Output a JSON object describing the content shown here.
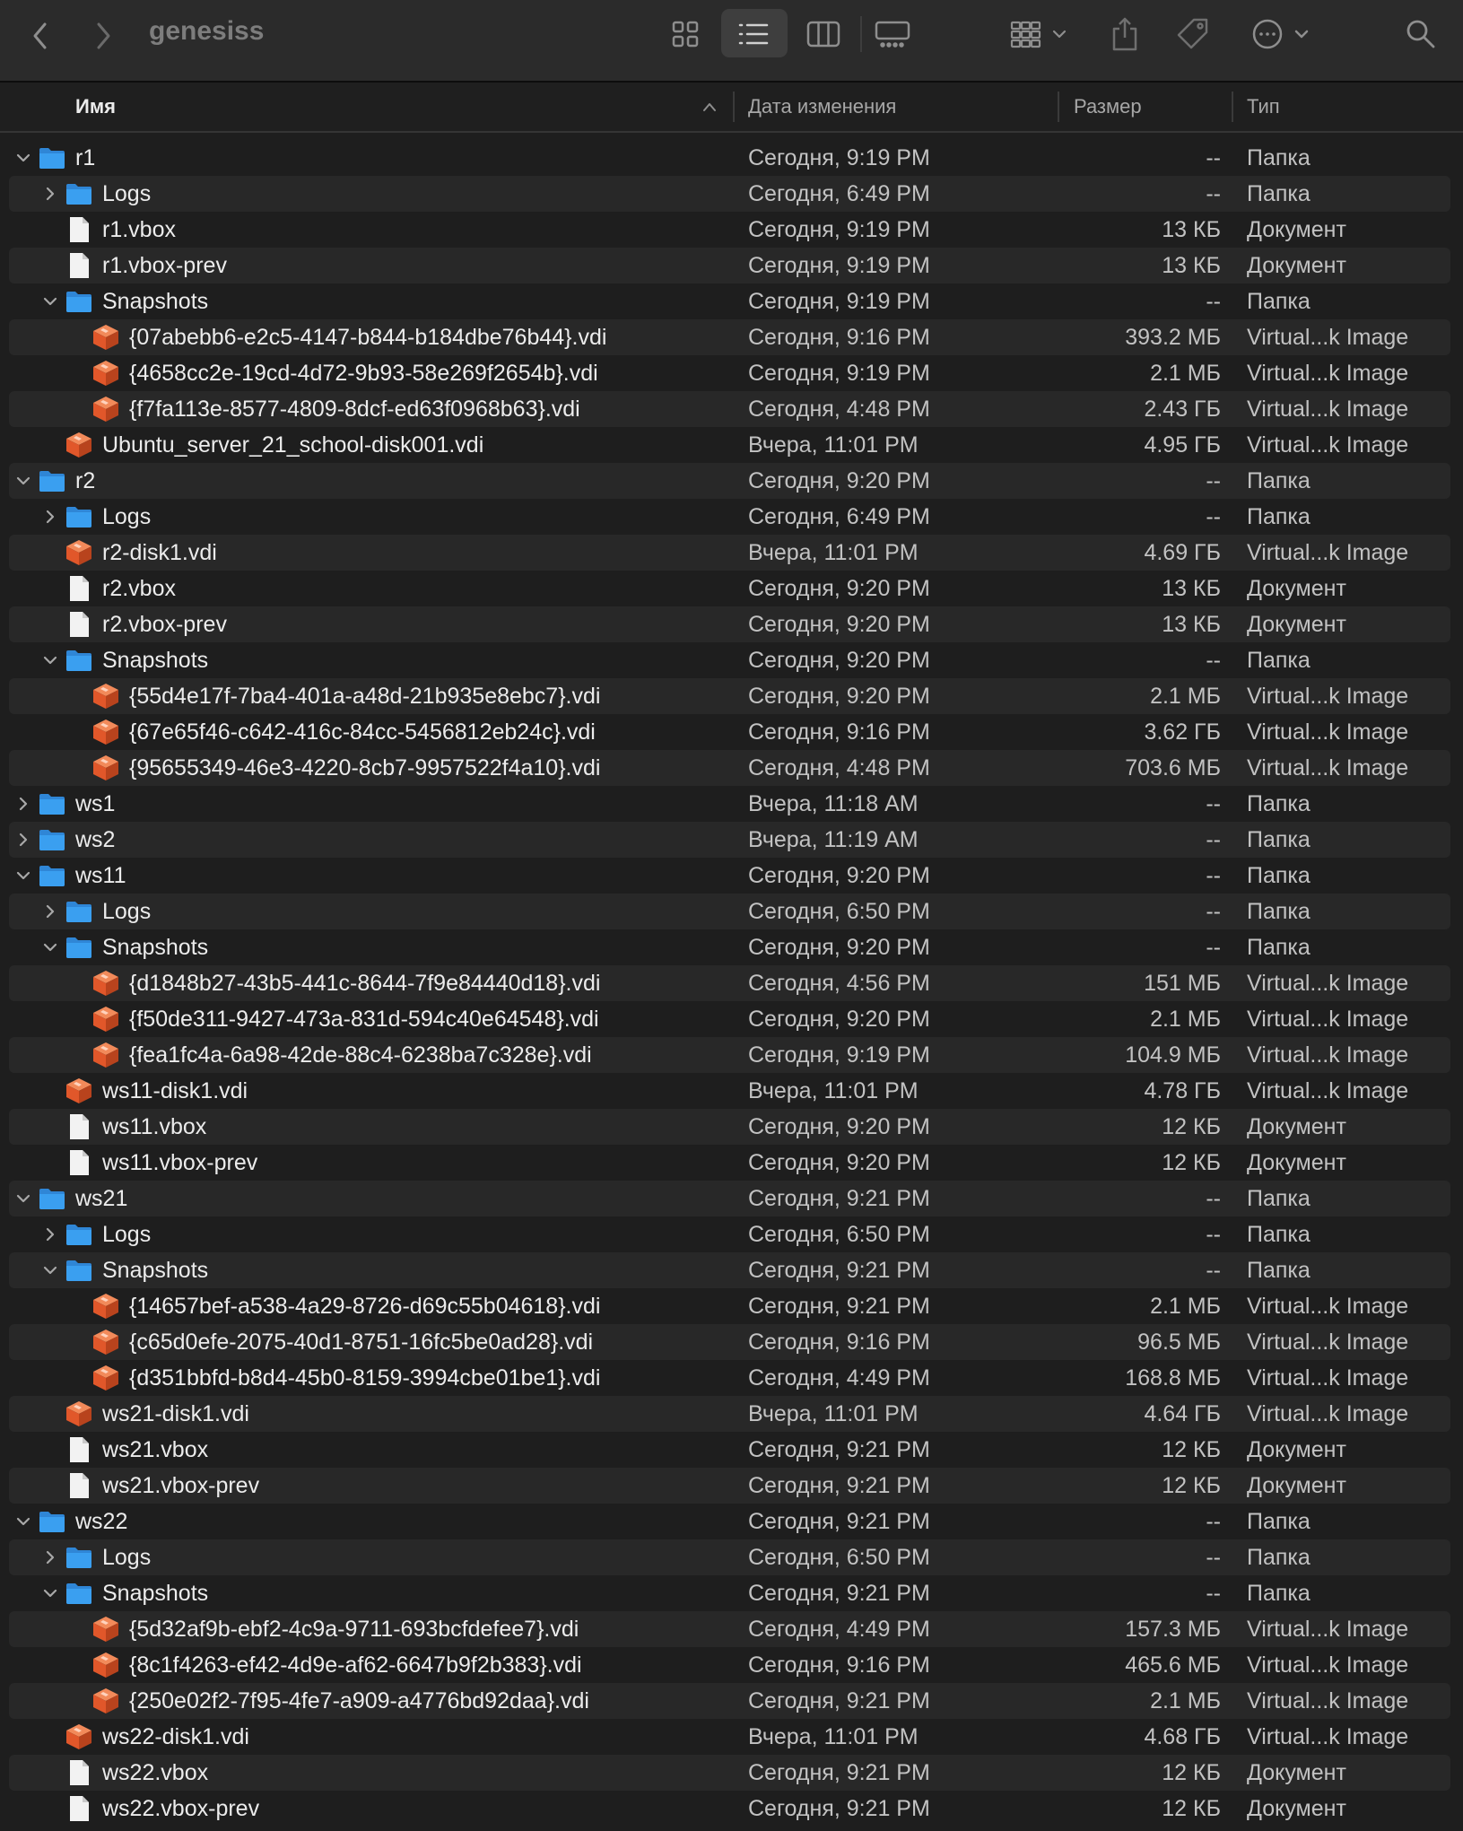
{
  "window": {
    "title": "genesiss",
    "back_label": "‹",
    "forward_label": "›"
  },
  "header": {
    "name": "Имя",
    "date": "Дата изменения",
    "size": "Размер",
    "type": "Тип"
  },
  "colors": {
    "folder": "#3a9ff0",
    "vdi": "#e1572a",
    "doc": "#f2f2f2",
    "alt_row": "#282828"
  },
  "icons": [
    "back-icon",
    "forward-icon",
    "icon-view-icon",
    "list-view-icon",
    "column-view-icon",
    "gallery-view-icon",
    "group-icon",
    "share-icon",
    "tag-icon",
    "more-icon",
    "search-icon"
  ],
  "rows": [
    {
      "level": 0,
      "kind": "folder",
      "disclosure": "open",
      "name": "r1",
      "date": "Сегодня, 9:19 PM",
      "size": "--",
      "type": "Папка"
    },
    {
      "level": 1,
      "kind": "folder",
      "disclosure": "closed",
      "name": "Logs",
      "date": "Сегодня, 6:49 PM",
      "size": "--",
      "type": "Папка"
    },
    {
      "level": 1,
      "kind": "doc",
      "disclosure": "none",
      "name": "r1.vbox",
      "date": "Сегодня, 9:19 PM",
      "size": "13 КБ",
      "type": "Документ"
    },
    {
      "level": 1,
      "kind": "doc",
      "disclosure": "none",
      "name": "r1.vbox-prev",
      "date": "Сегодня, 9:19 PM",
      "size": "13 КБ",
      "type": "Документ"
    },
    {
      "level": 1,
      "kind": "folder",
      "disclosure": "open",
      "name": "Snapshots",
      "date": "Сегодня, 9:19 PM",
      "size": "--",
      "type": "Папка"
    },
    {
      "level": 2,
      "kind": "vdi",
      "disclosure": "none",
      "name": "{07abebb6-e2c5-4147-b844-b184dbe76b44}.vdi",
      "date": "Сегодня, 9:16 PM",
      "size": "393.2 МБ",
      "type": "Virtual...k Image"
    },
    {
      "level": 2,
      "kind": "vdi",
      "disclosure": "none",
      "name": "{4658cc2e-19cd-4d72-9b93-58e269f2654b}.vdi",
      "date": "Сегодня, 9:19 PM",
      "size": "2.1 МБ",
      "type": "Virtual...k Image"
    },
    {
      "level": 2,
      "kind": "vdi",
      "disclosure": "none",
      "name": "{f7fa113e-8577-4809-8dcf-ed63f0968b63}.vdi",
      "date": "Сегодня, 4:48 PM",
      "size": "2.43 ГБ",
      "type": "Virtual...k Image"
    },
    {
      "level": 1,
      "kind": "vdi",
      "disclosure": "none",
      "name": "Ubuntu_server_21_school-disk001.vdi",
      "date": "Вчера, 11:01 PM",
      "size": "4.95 ГБ",
      "type": "Virtual...k Image"
    },
    {
      "level": 0,
      "kind": "folder",
      "disclosure": "open",
      "name": "r2",
      "date": "Сегодня, 9:20 PM",
      "size": "--",
      "type": "Папка"
    },
    {
      "level": 1,
      "kind": "folder",
      "disclosure": "closed",
      "name": "Logs",
      "date": "Сегодня, 6:49 PM",
      "size": "--",
      "type": "Папка"
    },
    {
      "level": 1,
      "kind": "vdi",
      "disclosure": "none",
      "name": "r2-disk1.vdi",
      "date": "Вчера, 11:01 PM",
      "size": "4.69 ГБ",
      "type": "Virtual...k Image"
    },
    {
      "level": 1,
      "kind": "doc",
      "disclosure": "none",
      "name": "r2.vbox",
      "date": "Сегодня, 9:20 PM",
      "size": "13 КБ",
      "type": "Документ"
    },
    {
      "level": 1,
      "kind": "doc",
      "disclosure": "none",
      "name": "r2.vbox-prev",
      "date": "Сегодня, 9:20 PM",
      "size": "13 КБ",
      "type": "Документ"
    },
    {
      "level": 1,
      "kind": "folder",
      "disclosure": "open",
      "name": "Snapshots",
      "date": "Сегодня, 9:20 PM",
      "size": "--",
      "type": "Папка"
    },
    {
      "level": 2,
      "kind": "vdi",
      "disclosure": "none",
      "name": "{55d4e17f-7ba4-401a-a48d-21b935e8ebc7}.vdi",
      "date": "Сегодня, 9:20 PM",
      "size": "2.1 МБ",
      "type": "Virtual...k Image"
    },
    {
      "level": 2,
      "kind": "vdi",
      "disclosure": "none",
      "name": "{67e65f46-c642-416c-84cc-5456812eb24c}.vdi",
      "date": "Сегодня, 9:16 PM",
      "size": "3.62 ГБ",
      "type": "Virtual...k Image"
    },
    {
      "level": 2,
      "kind": "vdi",
      "disclosure": "none",
      "name": "{95655349-46e3-4220-8cb7-9957522f4a10}.vdi",
      "date": "Сегодня, 4:48 PM",
      "size": "703.6 МБ",
      "type": "Virtual...k Image"
    },
    {
      "level": 0,
      "kind": "folder",
      "disclosure": "closed",
      "name": "ws1",
      "date": "Вчера, 11:18 AM",
      "size": "--",
      "type": "Папка"
    },
    {
      "level": 0,
      "kind": "folder",
      "disclosure": "closed",
      "name": "ws2",
      "date": "Вчера, 11:19 AM",
      "size": "--",
      "type": "Папка"
    },
    {
      "level": 0,
      "kind": "folder",
      "disclosure": "open",
      "name": "ws11",
      "date": "Сегодня, 9:20 PM",
      "size": "--",
      "type": "Папка"
    },
    {
      "level": 1,
      "kind": "folder",
      "disclosure": "closed",
      "name": "Logs",
      "date": "Сегодня, 6:50 PM",
      "size": "--",
      "type": "Папка"
    },
    {
      "level": 1,
      "kind": "folder",
      "disclosure": "open",
      "name": "Snapshots",
      "date": "Сегодня, 9:20 PM",
      "size": "--",
      "type": "Папка"
    },
    {
      "level": 2,
      "kind": "vdi",
      "disclosure": "none",
      "name": "{d1848b27-43b5-441c-8644-7f9e84440d18}.vdi",
      "date": "Сегодня, 4:56 PM",
      "size": "151 МБ",
      "type": "Virtual...k Image"
    },
    {
      "level": 2,
      "kind": "vdi",
      "disclosure": "none",
      "name": "{f50de311-9427-473a-831d-594c40e64548}.vdi",
      "date": "Сегодня, 9:20 PM",
      "size": "2.1 МБ",
      "type": "Virtual...k Image"
    },
    {
      "level": 2,
      "kind": "vdi",
      "disclosure": "none",
      "name": "{fea1fc4a-6a98-42de-88c4-6238ba7c328e}.vdi",
      "date": "Сегодня, 9:19 PM",
      "size": "104.9 МБ",
      "type": "Virtual...k Image"
    },
    {
      "level": 1,
      "kind": "vdi",
      "disclosure": "none",
      "name": "ws11-disk1.vdi",
      "date": "Вчера, 11:01 PM",
      "size": "4.78 ГБ",
      "type": "Virtual...k Image"
    },
    {
      "level": 1,
      "kind": "doc",
      "disclosure": "none",
      "name": "ws11.vbox",
      "date": "Сегодня, 9:20 PM",
      "size": "12 КБ",
      "type": "Документ"
    },
    {
      "level": 1,
      "kind": "doc",
      "disclosure": "none",
      "name": "ws11.vbox-prev",
      "date": "Сегодня, 9:20 PM",
      "size": "12 КБ",
      "type": "Документ"
    },
    {
      "level": 0,
      "kind": "folder",
      "disclosure": "open",
      "name": "ws21",
      "date": "Сегодня, 9:21 PM",
      "size": "--",
      "type": "Папка"
    },
    {
      "level": 1,
      "kind": "folder",
      "disclosure": "closed",
      "name": "Logs",
      "date": "Сегодня, 6:50 PM",
      "size": "--",
      "type": "Папка"
    },
    {
      "level": 1,
      "kind": "folder",
      "disclosure": "open",
      "name": "Snapshots",
      "date": "Сегодня, 9:21 PM",
      "size": "--",
      "type": "Папка"
    },
    {
      "level": 2,
      "kind": "vdi",
      "disclosure": "none",
      "name": "{14657bef-a538-4a29-8726-d69c55b04618}.vdi",
      "date": "Сегодня, 9:21 PM",
      "size": "2.1 МБ",
      "type": "Virtual...k Image"
    },
    {
      "level": 2,
      "kind": "vdi",
      "disclosure": "none",
      "name": "{c65d0efe-2075-40d1-8751-16fc5be0ad28}.vdi",
      "date": "Сегодня, 9:16 PM",
      "size": "96.5 МБ",
      "type": "Virtual...k Image"
    },
    {
      "level": 2,
      "kind": "vdi",
      "disclosure": "none",
      "name": "{d351bbfd-b8d4-45b0-8159-3994cbe01be1}.vdi",
      "date": "Сегодня, 4:49 PM",
      "size": "168.8 МБ",
      "type": "Virtual...k Image"
    },
    {
      "level": 1,
      "kind": "vdi",
      "disclosure": "none",
      "name": "ws21-disk1.vdi",
      "date": "Вчера, 11:01 PM",
      "size": "4.64 ГБ",
      "type": "Virtual...k Image"
    },
    {
      "level": 1,
      "kind": "doc",
      "disclosure": "none",
      "name": "ws21.vbox",
      "date": "Сегодня, 9:21 PM",
      "size": "12 КБ",
      "type": "Документ"
    },
    {
      "level": 1,
      "kind": "doc",
      "disclosure": "none",
      "name": "ws21.vbox-prev",
      "date": "Сегодня, 9:21 PM",
      "size": "12 КБ",
      "type": "Документ"
    },
    {
      "level": 0,
      "kind": "folder",
      "disclosure": "open",
      "name": "ws22",
      "date": "Сегодня, 9:21 PM",
      "size": "--",
      "type": "Папка"
    },
    {
      "level": 1,
      "kind": "folder",
      "disclosure": "closed",
      "name": "Logs",
      "date": "Сегодня, 6:50 PM",
      "size": "--",
      "type": "Папка"
    },
    {
      "level": 1,
      "kind": "folder",
      "disclosure": "open",
      "name": "Snapshots",
      "date": "Сегодня, 9:21 PM",
      "size": "--",
      "type": "Папка"
    },
    {
      "level": 2,
      "kind": "vdi",
      "disclosure": "none",
      "name": "{5d32af9b-ebf2-4c9a-9711-693bcfdefee7}.vdi",
      "date": "Сегодня, 4:49 PM",
      "size": "157.3 МБ",
      "type": "Virtual...k Image"
    },
    {
      "level": 2,
      "kind": "vdi",
      "disclosure": "none",
      "name": "{8c1f4263-ef42-4d9e-af62-6647b9f2b383}.vdi",
      "date": "Сегодня, 9:16 PM",
      "size": "465.6 МБ",
      "type": "Virtual...k Image"
    },
    {
      "level": 2,
      "kind": "vdi",
      "disclosure": "none",
      "name": "{250e02f2-7f95-4fe7-a909-a4776bd92daa}.vdi",
      "date": "Сегодня, 9:21 PM",
      "size": "2.1 МБ",
      "type": "Virtual...k Image"
    },
    {
      "level": 1,
      "kind": "vdi",
      "disclosure": "none",
      "name": "ws22-disk1.vdi",
      "date": "Вчера, 11:01 PM",
      "size": "4.68 ГБ",
      "type": "Virtual...k Image"
    },
    {
      "level": 1,
      "kind": "doc",
      "disclosure": "none",
      "name": "ws22.vbox",
      "date": "Сегодня, 9:21 PM",
      "size": "12 КБ",
      "type": "Документ"
    },
    {
      "level": 1,
      "kind": "doc",
      "disclosure": "none",
      "name": "ws22.vbox-prev",
      "date": "Сегодня, 9:21 PM",
      "size": "12 КБ",
      "type": "Документ"
    }
  ]
}
